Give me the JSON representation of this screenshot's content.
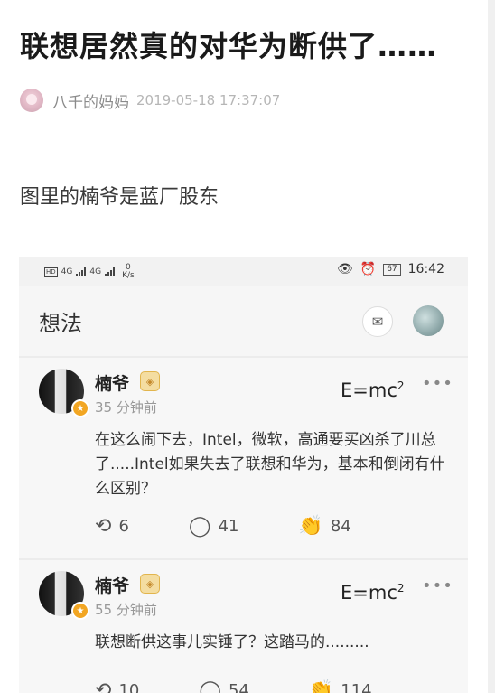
{
  "article": {
    "title": "联想居然真的对华为断供了……",
    "author": "八千的妈妈",
    "date": "2019-05-18 17:37:07",
    "body": "图里的楠爷是蓝厂股东"
  },
  "screenshot": {
    "status_bar": {
      "hd": "HD",
      "net1": "4G",
      "net2": "4G",
      "speed_value": "0",
      "speed_unit": "K/s",
      "battery": "67",
      "time": "16:42"
    },
    "app_header": {
      "title": "想法",
      "mail_icon": "mail-icon",
      "avatar": "profile-avatar"
    },
    "posts": [
      {
        "user": "楠爷",
        "time": "35 分钟前",
        "formula_base": "E=mc",
        "formula_sup": "2",
        "more": "•••",
        "content": "在这么闹下去，Intel，微软，高通要买凶杀了川总了.....Intel如果失去了联想和华为，基本和倒闭有什么区别？",
        "reposts": "6",
        "comments": "41",
        "likes": "84"
      },
      {
        "user": "楠爷",
        "time": "55 分钟前",
        "formula_base": "E=mc",
        "formula_sup": "2",
        "more": "•••",
        "content": "联想断供这事儿实锤了？这踏马的.........",
        "reposts": "10",
        "comments": "54",
        "likes": "114"
      }
    ]
  },
  "colors": {
    "title": "#1a1a1a",
    "meta_text": "#8a8a8a",
    "badge_gold": "#f2a623"
  }
}
